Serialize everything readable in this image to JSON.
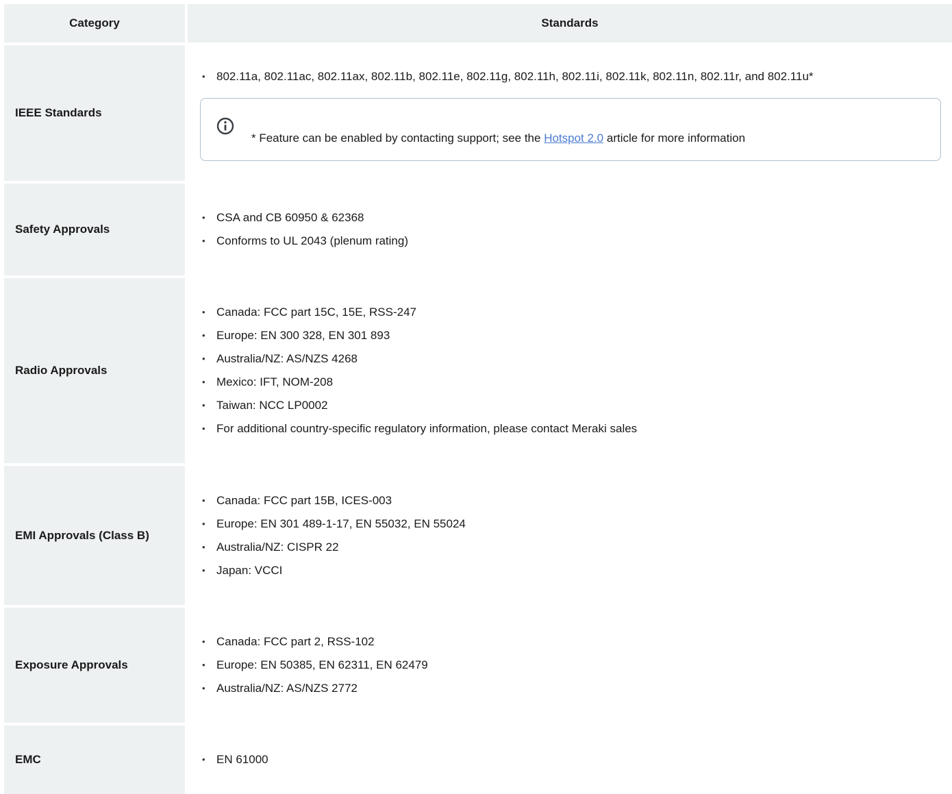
{
  "header": {
    "category": "Category",
    "standards": "Standards"
  },
  "rows": [
    {
      "category": "IEEE Standards",
      "items": [
        "802.11a, 802.11ac, 802.11ax, 802.11b, 802.11e, 802.11g, 802.11h, 802.11i, 802.11k, 802.11n, 802.11r, and 802.11u*"
      ],
      "note": {
        "icon": "info-icon",
        "prefix": "* Feature can be enabled by contacting support; see the ",
        "link": "Hotspot 2.0",
        "suffix": " article for more information"
      }
    },
    {
      "category": "Safety Approvals",
      "items": [
        "CSA and CB 60950 & 62368",
        "Conforms to UL 2043 (plenum rating)"
      ]
    },
    {
      "category": "Radio Approvals",
      "items": [
        "Canada: FCC part 15C, 15E, RSS-247",
        "Europe: EN 300 328, EN 301 893",
        "Australia/NZ: AS/NZS 4268",
        "Mexico: IFT, NOM-208",
        "Taiwan: NCC LP0002",
        "For additional country-specific regulatory information, please contact Meraki sales"
      ]
    },
    {
      "category": "EMI Approvals (Class B)",
      "items": [
        "Canada: FCC part 15B, ICES-003",
        "Europe: EN 301 489-1-17, EN 55032, EN 55024",
        "Australia/NZ: CISPR 22",
        "Japan: VCCI"
      ]
    },
    {
      "category": "Exposure Approvals",
      "items": [
        "Canada: FCC part 2, RSS-102",
        "Europe: EN 50385, EN 62311, EN 62479",
        "Australia/NZ: AS/NZS 2772"
      ]
    },
    {
      "category": "EMC",
      "items": [
        "EN 61000"
      ]
    }
  ],
  "colors": {
    "header_bg": "#eef1f2",
    "category_bg": "#eef1f2",
    "link": "#4a7bd0",
    "note_border": "#aebfcc"
  }
}
